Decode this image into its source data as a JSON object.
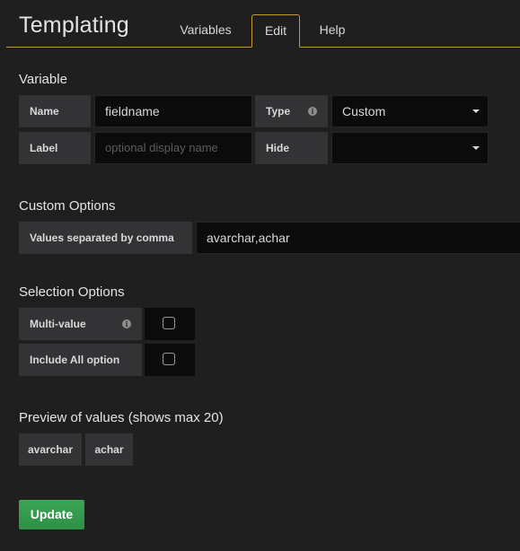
{
  "header": {
    "title": "Templating",
    "tabs": [
      {
        "label": "Variables"
      },
      {
        "label": "Edit"
      },
      {
        "label": "Help"
      }
    ]
  },
  "variable": {
    "section_title": "Variable",
    "name_label": "Name",
    "name_value": "fieldname",
    "type_label": "Type",
    "type_value": "Custom",
    "label_label": "Label",
    "label_placeholder": "optional display name",
    "hide_label": "Hide",
    "hide_value": ""
  },
  "custom_options": {
    "section_title": "Custom Options",
    "values_label": "Values separated by comma",
    "values_value": "avarchar,achar"
  },
  "selection_options": {
    "section_title": "Selection Options",
    "multi_value_label": "Multi-value",
    "multi_value_checked": false,
    "include_all_label": "Include All option",
    "include_all_checked": false
  },
  "preview": {
    "section_title": "Preview of values (shows max 20)",
    "values": [
      "avarchar",
      "achar"
    ]
  },
  "update_label": "Update",
  "colors": {
    "accent": "#c49a2c",
    "update_button": "#2f8f46"
  }
}
